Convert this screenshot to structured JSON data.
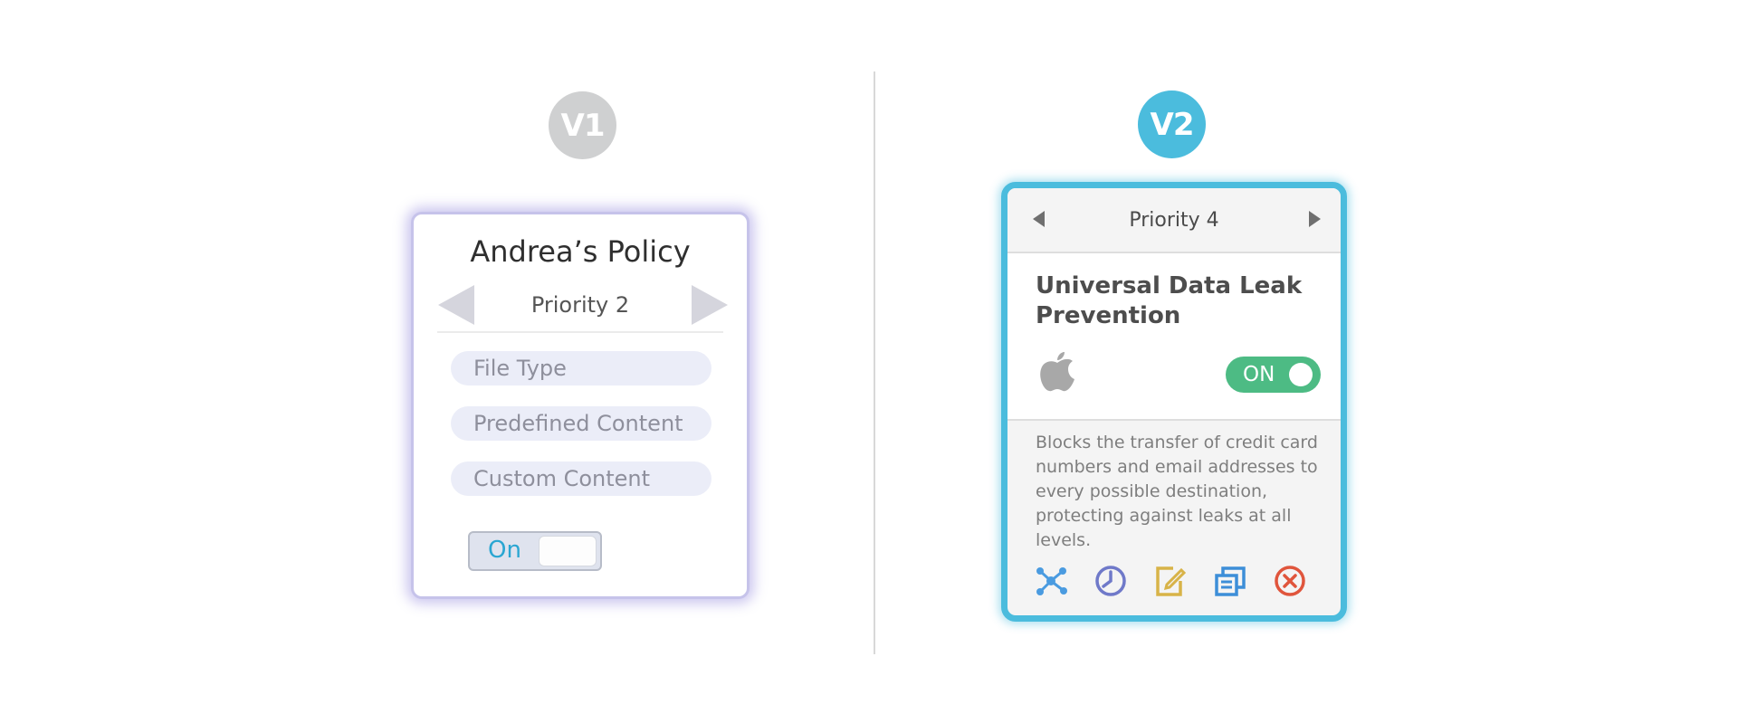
{
  "v1": {
    "badge": "V1",
    "title": "Andrea’s Policy",
    "priority": "Priority 2",
    "pills": [
      "File Type",
      "Predefined Content",
      "Custom Content"
    ],
    "toggle_label": "On"
  },
  "v2": {
    "badge": "V2",
    "priority": "Priority 4",
    "title": "Universal Data Leak Prevention",
    "toggle_label": "ON",
    "description": "Blocks the transfer of credit card numbers and email addresses to every possible destination, protecting against leaks at all levels.",
    "platform_icon": "apple-icon",
    "actions": [
      "network-icon",
      "clock-icon",
      "edit-icon",
      "copy-icon",
      "delete-icon"
    ]
  },
  "colors": {
    "v1_badge": "#cfd0d1",
    "v2_accent": "#4bbcdd",
    "v1_glow": "#8c80dc",
    "toggle_on": "#4dbb84",
    "action_network": "#4a9be0",
    "action_clock": "#6f79c9",
    "action_edit": "#d8b348",
    "action_copy": "#3d8ed8",
    "action_delete": "#e0553c"
  }
}
